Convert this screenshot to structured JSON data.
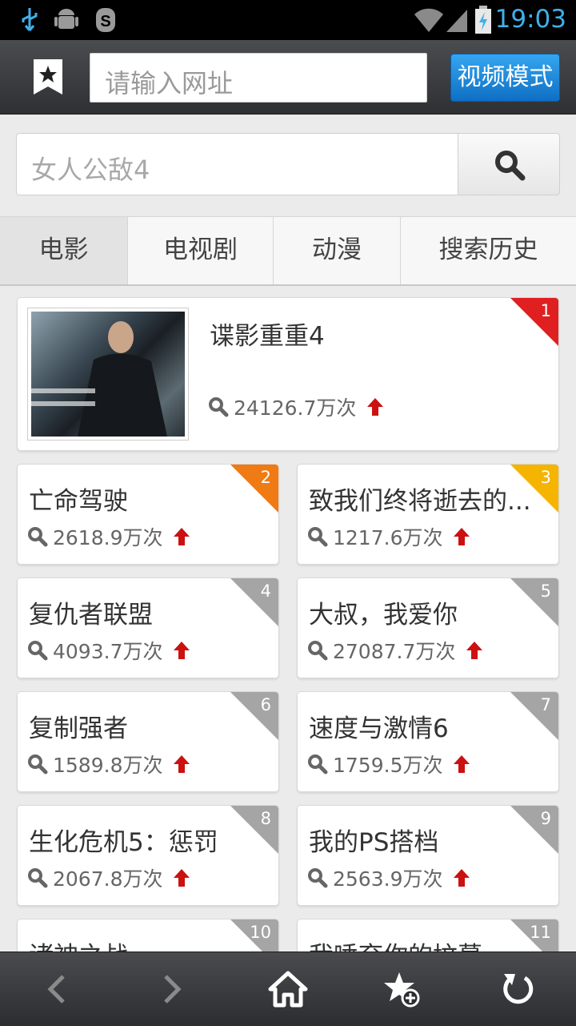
{
  "status_bar": {
    "time": "19:03"
  },
  "url_bar": {
    "placeholder": "请输入网址",
    "video_mode_label": "视频模式"
  },
  "search": {
    "value": "女人公敌4"
  },
  "tabs": [
    {
      "label": "电影",
      "active": true
    },
    {
      "label": "电视剧",
      "active": false
    },
    {
      "label": "动漫",
      "active": false
    },
    {
      "label": "搜索历史",
      "active": false
    }
  ],
  "colors": {
    "rank1": "#e02020",
    "rank2": "#f07a14",
    "rank3": "#f5b400",
    "rank_other": "#a5a5a5",
    "trend_up": "#cc1111",
    "accent": "#1b88dd"
  },
  "featured": {
    "rank": "1",
    "title": "谍影重重4",
    "views": "24126.7万次",
    "trend": "up"
  },
  "items": [
    {
      "rank": "2",
      "title": "亡命驾驶",
      "views": "2618.9万次",
      "trend": "up"
    },
    {
      "rank": "3",
      "title": "致我们终将逝去的...",
      "views": "1217.6万次",
      "trend": "up"
    },
    {
      "rank": "4",
      "title": "复仇者联盟",
      "views": "4093.7万次",
      "trend": "up"
    },
    {
      "rank": "5",
      "title": "大叔，我爱你",
      "views": "27087.7万次",
      "trend": "up"
    },
    {
      "rank": "6",
      "title": "复制强者",
      "views": "1589.8万次",
      "trend": "up"
    },
    {
      "rank": "7",
      "title": "速度与激情6",
      "views": "1759.5万次",
      "trend": "up"
    },
    {
      "rank": "8",
      "title": "生化危机5：惩罚",
      "views": "2067.8万次",
      "trend": "up"
    },
    {
      "rank": "9",
      "title": "我的PS搭档",
      "views": "2563.9万次",
      "trend": "up"
    },
    {
      "rank": "10",
      "title": "诸神之战",
      "views": "",
      "trend": "up"
    },
    {
      "rank": "11",
      "title": "我唾弃你的坟墓",
      "views": "",
      "trend": "up"
    }
  ],
  "bottom_nav": [
    "back-icon",
    "forward-icon",
    "home-icon",
    "add-favorite-icon",
    "refresh-icon"
  ]
}
